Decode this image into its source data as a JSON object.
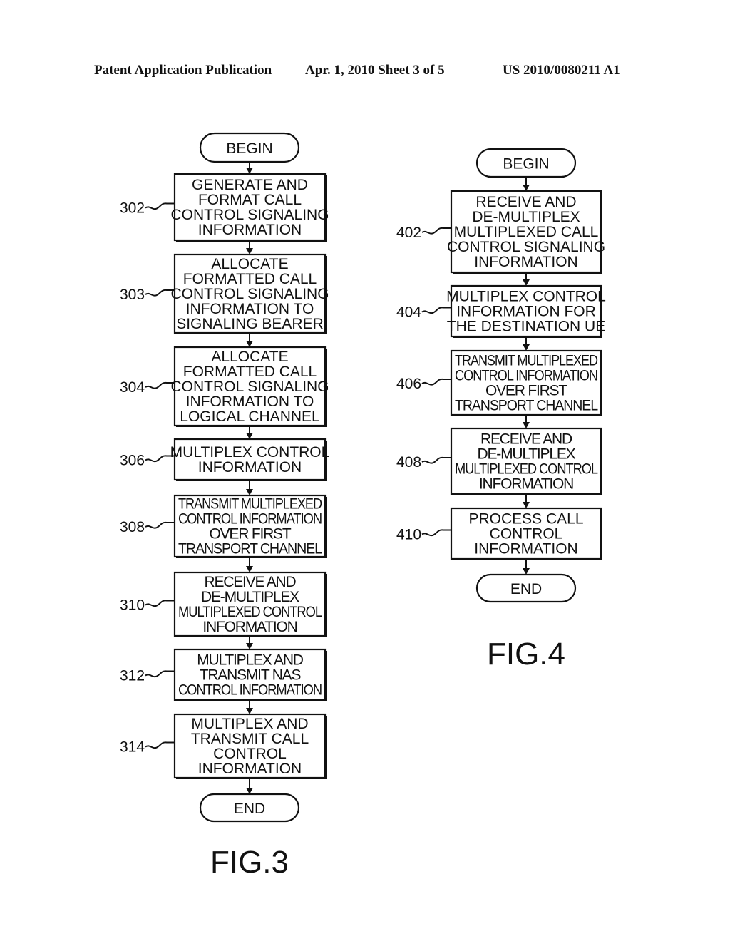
{
  "header": {
    "left": "Patent Application Publication",
    "middle": "Apr. 1, 2010   Sheet 3 of 5",
    "right": "US 2010/0080211 A1"
  },
  "figures": [
    {
      "id": "fig3",
      "label": "FIG.3",
      "begin": "BEGIN",
      "end": "END",
      "steps": [
        {
          "ref": "302",
          "lines": [
            "GENERATE AND",
            "FORMAT CALL",
            "CONTROL SIGNALING",
            "INFORMATION"
          ]
        },
        {
          "ref": "303",
          "lines": [
            "ALLOCATE",
            "FORMATTED CALL",
            "CONTROL SIGNALING",
            "INFORMATION TO",
            "SIGNALING BEARER"
          ]
        },
        {
          "ref": "304",
          "lines": [
            "ALLOCATE",
            "FORMATTED CALL",
            "CONTROL SIGNALING",
            "INFORMATION TO",
            "LOGICAL CHANNEL"
          ]
        },
        {
          "ref": "306",
          "lines": [
            "MULTIPLEX CONTROL",
            "INFORMATION"
          ]
        },
        {
          "ref": "308",
          "lines": [
            "TRANSMIT MULTIPLEXED",
            "CONTROL INFORMATION",
            "OVER FIRST",
            "TRANSPORT CHANNEL"
          ]
        },
        {
          "ref": "310",
          "lines": [
            "RECEIVE AND",
            "DE-MULTIPLEX",
            "MULTIPLEXED CONTROL",
            "INFORMATION"
          ]
        },
        {
          "ref": "312",
          "lines": [
            "MULTIPLEX AND",
            "TRANSMIT NAS",
            "CONTROL INFORMATION"
          ]
        },
        {
          "ref": "314",
          "lines": [
            "MULTIPLEX AND",
            "TRANSMIT CALL",
            "CONTROL",
            "INFORMATION"
          ]
        }
      ]
    },
    {
      "id": "fig4",
      "label": "FIG.4",
      "begin": "BEGIN",
      "end": "END",
      "steps": [
        {
          "ref": "402",
          "lines": [
            "RECEIVE AND",
            "DE-MULTIPLEX",
            "MULTIPLEXED CALL",
            "CONTROL SIGNALING",
            "INFORMATION"
          ]
        },
        {
          "ref": "404",
          "lines": [
            "MULTIPLEX CONTROL",
            "INFORMATION FOR",
            "THE DESTINATION UE"
          ]
        },
        {
          "ref": "406",
          "lines": [
            "TRANSMIT MULTIPLEXED",
            "CONTROL INFORMATION",
            "OVER FIRST",
            "TRANSPORT CHANNEL"
          ]
        },
        {
          "ref": "408",
          "lines": [
            "RECEIVE AND",
            "DE-MULTIPLEX",
            "MULTIPLEXED CONTROL",
            "INFORMATION"
          ]
        },
        {
          "ref": "410",
          "lines": [
            "PROCESS CALL",
            "CONTROL",
            "INFORMATION"
          ]
        }
      ]
    }
  ]
}
